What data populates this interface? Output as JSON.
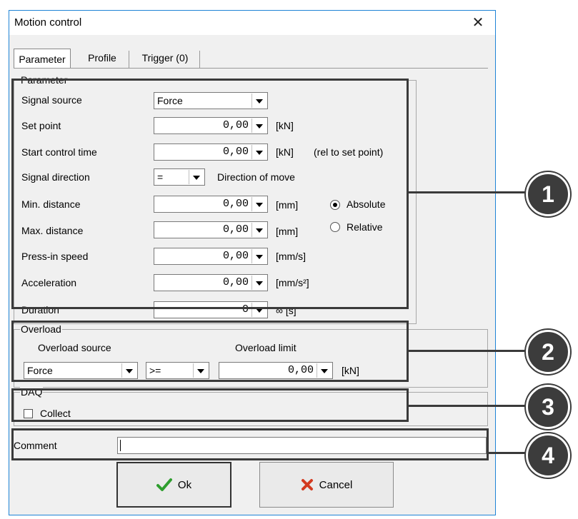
{
  "window": {
    "title": "Motion control",
    "close_glyph": "✕"
  },
  "tabs": [
    {
      "label": "Parameter",
      "active": true
    },
    {
      "label": "Profile",
      "active": false
    },
    {
      "label": "Trigger (0)",
      "active": false
    }
  ],
  "parameter": {
    "legend": "Parameter",
    "rows": [
      {
        "label": "Signal source",
        "value": "Force",
        "unit": ""
      },
      {
        "label": "Set point",
        "value": "0,00",
        "unit": "[kN]"
      },
      {
        "label": "Start control time",
        "value": "0,00",
        "unit": "[kN]",
        "note": "(rel to set point)"
      },
      {
        "label": "Signal direction",
        "value": "=",
        "unit": "Direction of move"
      },
      {
        "label": "Min. distance",
        "value": "0,00",
        "unit": "[mm]"
      },
      {
        "label": "Max. distance",
        "value": "0,00",
        "unit": "[mm]"
      },
      {
        "label": "Press-in speed",
        "value": "0,00",
        "unit": "[mm/s]"
      },
      {
        "label": "Acceleration",
        "value": "0,00",
        "unit": "[mm/s²]"
      },
      {
        "label": "Duration",
        "value": "0",
        "unit": "∞ [s]"
      }
    ],
    "mode": {
      "absolute": "Absolute",
      "relative": "Relative",
      "selected": "absolute"
    }
  },
  "overload": {
    "legend": "Overload",
    "source_label": "Overload source",
    "limit_label": "Overload limit",
    "source_value": "Force",
    "operator_value": ">=",
    "limit_value": "0,00",
    "limit_unit": "[kN]"
  },
  "daq": {
    "legend": "DAQ",
    "collect_label": "Collect",
    "collect_checked": false
  },
  "comment": {
    "label": "Comment",
    "value": ""
  },
  "buttons": {
    "ok": "Ok",
    "cancel": "Cancel"
  },
  "callouts": [
    "1",
    "2",
    "3",
    "4"
  ],
  "colors": {
    "window_border": "#1e83d6",
    "ok_check": "#2e9e2e",
    "cancel_x": "#d33a1f",
    "callout_fill": "#3c3c3c"
  }
}
